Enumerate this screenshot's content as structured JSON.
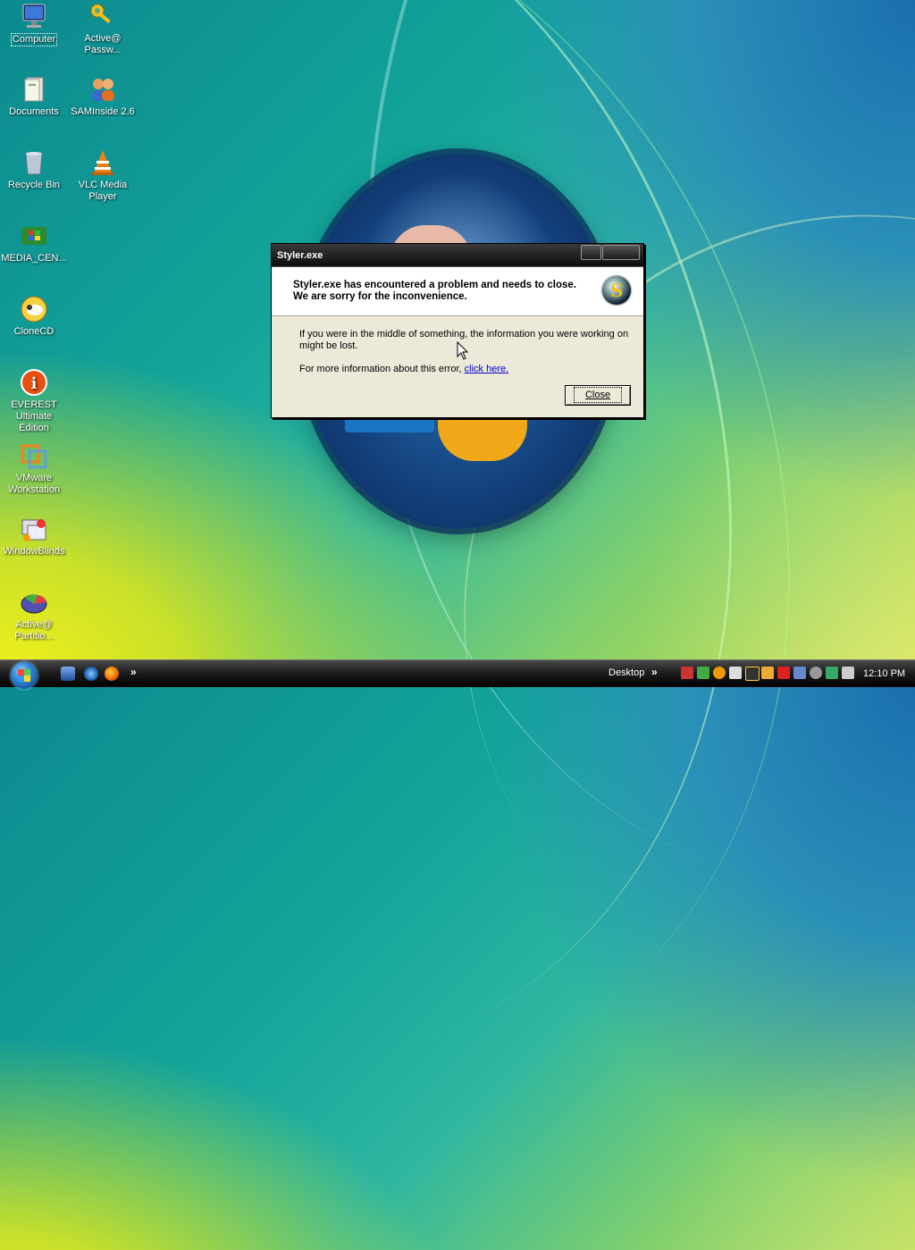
{
  "desktop": {
    "icons": [
      {
        "label": "Computer",
        "icon": "computer-icon"
      },
      {
        "label": "Active@ Passw...",
        "icon": "key-icon"
      },
      {
        "label": "Documents",
        "icon": "documents-icon"
      },
      {
        "label": "SAMInside 2.6",
        "icon": "users-icon"
      },
      {
        "label": "Recycle Bin",
        "icon": "recycle-bin-icon"
      },
      {
        "label": "VLC Media Player",
        "icon": "vlc-cone-icon"
      },
      {
        "label": "MEDIA_CEN...",
        "icon": "windows-flag-icon"
      },
      {
        "label": "CloneCD",
        "icon": "clonecd-sheep-icon"
      },
      {
        "label": "EVEREST Ultimate Edition",
        "icon": "info-icon"
      },
      {
        "label": "VMware Workstation",
        "icon": "vmware-icon"
      },
      {
        "label": "WindowBlinds",
        "icon": "windowblinds-icon"
      },
      {
        "label": "Active@ Partitio...",
        "icon": "partition-disk-icon"
      }
    ]
  },
  "dialog": {
    "title": "Styler.exe",
    "headline": "Styler.exe has encountered a problem and needs to close.  We are sorry for the inconvenience.",
    "body": "If you were in the middle of something, the information you were working on might be lost.",
    "more_info_prefix": "For more information about this error, ",
    "more_info_link": "click here.",
    "close_label": "Close",
    "logo_letter": "S"
  },
  "taskbar": {
    "overflow_glyph": "»",
    "desktop_label": "Desktop",
    "desktop_chevron": "»",
    "clock": "12:10 PM",
    "quick_launch": [
      "show-desktop-icon",
      "internet-explorer-icon",
      "firefox-icon"
    ],
    "tray_icons": [
      "tray-icon-1",
      "tray-icon-2",
      "tray-icon-3",
      "tray-icon-4",
      "tray-icon-5",
      "tray-icon-6",
      "tray-icon-7",
      "tray-icon-8",
      "tray-icon-9",
      "tray-icon-10",
      "tray-icon-11",
      "tray-icon-12",
      "tray-icon-13"
    ]
  }
}
